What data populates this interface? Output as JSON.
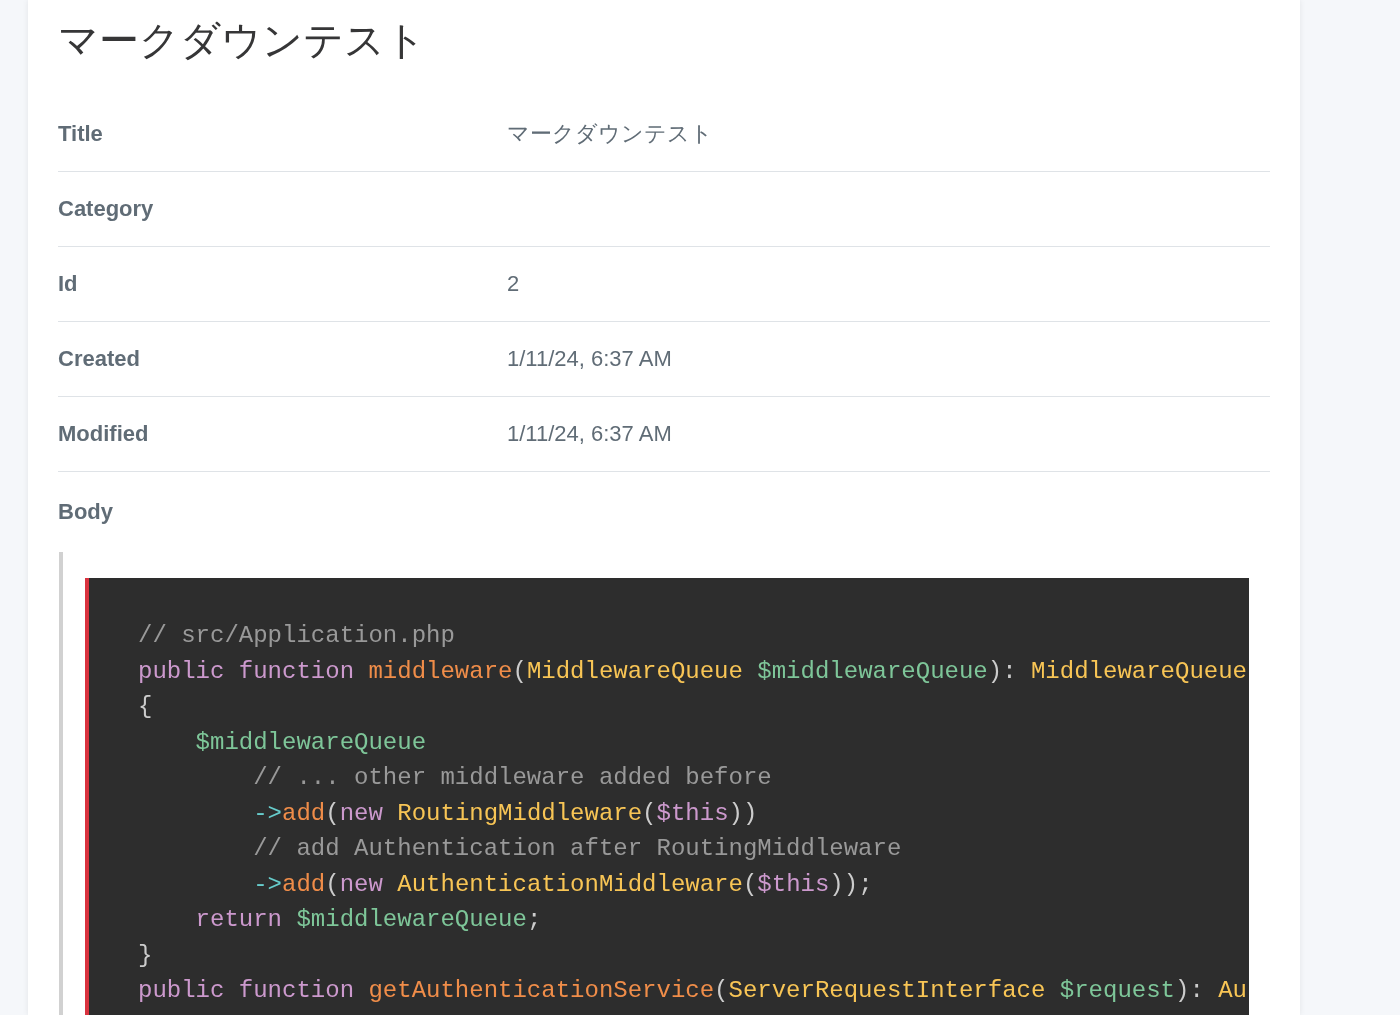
{
  "page": {
    "heading": "マークダウンテスト"
  },
  "fields": [
    {
      "label": "Title",
      "value": "マークダウンテスト"
    },
    {
      "label": "Category"
    },
    {
      "label": "Id",
      "value": "2"
    },
    {
      "label": "Created",
      "value": "1/11/24, 6:37 AM"
    },
    {
      "label": "Modified",
      "value": "1/11/24, 6:37 AM"
    }
  ],
  "body": {
    "label": "Body",
    "code_lines": [
      [
        {
          "kind": "comment",
          "text": "// src/Application.php"
        }
      ],
      [
        {
          "kind": "keyword",
          "text": "public function "
        },
        {
          "kind": "function",
          "text": "middleware"
        },
        {
          "kind": "punct",
          "text": "("
        },
        {
          "kind": "class",
          "text": "MiddlewareQueue "
        },
        {
          "kind": "variable",
          "text": "$middlewareQueue"
        },
        {
          "kind": "punct",
          "text": "): "
        },
        {
          "kind": "class",
          "text": "MiddlewareQueue"
        }
      ],
      [
        {
          "kind": "punct",
          "text": "{"
        }
      ],
      [
        {
          "kind": "variable",
          "text": "    $middlewareQueue"
        }
      ],
      [
        {
          "kind": "comment",
          "text": "        // ... other middleware added before"
        }
      ],
      [
        {
          "kind": "arrow",
          "text": "        ->"
        },
        {
          "kind": "function",
          "text": "add"
        },
        {
          "kind": "punct",
          "text": "("
        },
        {
          "kind": "keyword",
          "text": "new "
        },
        {
          "kind": "class",
          "text": "RoutingMiddleware"
        },
        {
          "kind": "punct",
          "text": "("
        },
        {
          "kind": "keyword",
          "text": "$this"
        },
        {
          "kind": "punct",
          "text": "))"
        }
      ],
      [
        {
          "kind": "comment",
          "text": "        // add Authentication after RoutingMiddleware"
        }
      ],
      [
        {
          "kind": "arrow",
          "text": "        ->"
        },
        {
          "kind": "function",
          "text": "add"
        },
        {
          "kind": "punct",
          "text": "("
        },
        {
          "kind": "keyword",
          "text": "new "
        },
        {
          "kind": "class",
          "text": "AuthenticationMiddleware"
        },
        {
          "kind": "punct",
          "text": "("
        },
        {
          "kind": "keyword",
          "text": "$this"
        },
        {
          "kind": "punct",
          "text": "));"
        }
      ],
      [
        {
          "kind": "keyword",
          "text": "    return "
        },
        {
          "kind": "variable",
          "text": "$middlewareQueue"
        },
        {
          "kind": "punct",
          "text": ";"
        }
      ],
      [
        {
          "kind": "punct",
          "text": "}"
        }
      ],
      [
        {
          "kind": "keyword",
          "text": "public function "
        },
        {
          "kind": "function",
          "text": "getAuthenticationService"
        },
        {
          "kind": "punct",
          "text": "("
        },
        {
          "kind": "class",
          "text": "ServerRequestInterface "
        },
        {
          "kind": "variable",
          "text": "$request"
        },
        {
          "kind": "punct",
          "text": "): "
        },
        {
          "kind": "class",
          "text": "Au"
        }
      ]
    ]
  }
}
